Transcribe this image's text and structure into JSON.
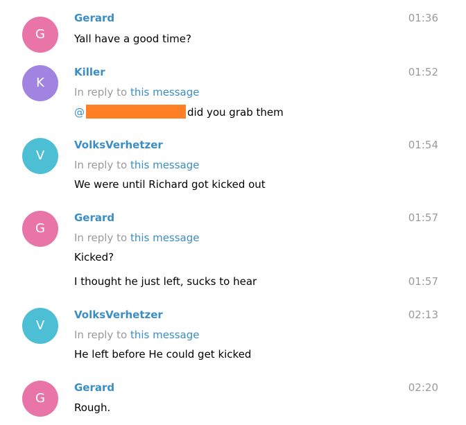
{
  "colors": {
    "pink_avatar": "#e874a8",
    "purple_avatar": "#a183e2",
    "teal_avatar": "#4dbfd4",
    "author_blue": "#3a8ec4",
    "time_gray": "#9a9a9a",
    "redaction_orange": "#ff7f27"
  },
  "messages": [
    {
      "avatar_initial": "G",
      "author": "Gerard",
      "time": "01:36",
      "text": "Yall have a good time?"
    },
    {
      "avatar_initial": "K",
      "author": "Killer",
      "time": "01:52",
      "reply_prefix": "In reply to ",
      "reply_link": "this message",
      "mention_prefix": "@",
      "text_after_redaction": "did you grab them"
    },
    {
      "avatar_initial": "V",
      "author": "VolksVerhetzer",
      "time": "01:54",
      "reply_prefix": "In reply to ",
      "reply_link": "this message",
      "text": "We were until Richard got kicked out"
    },
    {
      "avatar_initial": "G",
      "author": "Gerard",
      "time": "01:57",
      "reply_prefix": "In reply to ",
      "reply_link": "this message",
      "text": "Kicked?",
      "followup_text": "I thought he just left, sucks to hear",
      "followup_time": "01:57"
    },
    {
      "avatar_initial": "V",
      "author": "VolksVerhetzer",
      "time": "02:13",
      "reply_prefix": "In reply to ",
      "reply_link": "this message",
      "text": "He left before He could get kicked"
    },
    {
      "avatar_initial": "G",
      "author": "Gerard",
      "time": "02:20",
      "text": "Rough."
    }
  ]
}
